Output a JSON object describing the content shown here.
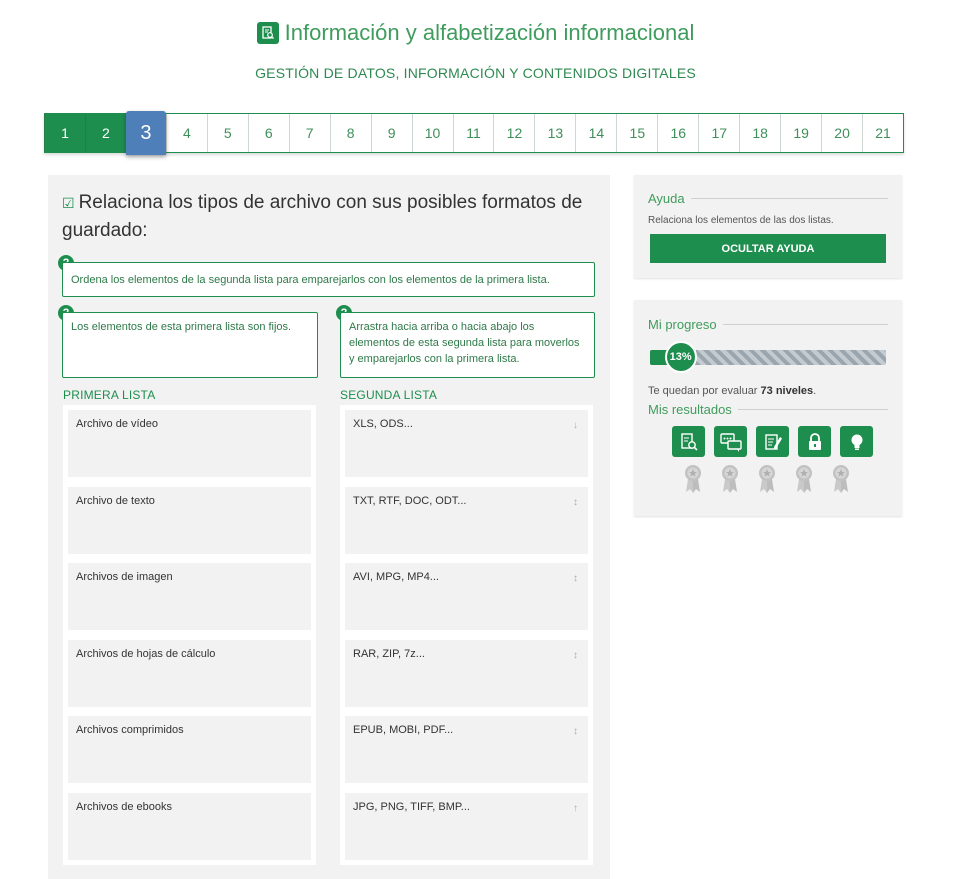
{
  "header": {
    "title": "Información y alfabetización informacional",
    "subtitle": "GESTIÓN DE DATOS, INFORMACIÓN Y CONTENIDOS DIGITALES",
    "icon": "document-search-icon"
  },
  "stepper": {
    "steps": [
      "1",
      "2",
      "3",
      "4",
      "5",
      "6",
      "7",
      "8",
      "9",
      "10",
      "11",
      "12",
      "13",
      "14",
      "15",
      "16",
      "17",
      "18",
      "19",
      "20",
      "21"
    ],
    "current": "3"
  },
  "question": {
    "text": "Relaciona los tipos de archivo con sus posibles formatos de guardado:",
    "icon": "checkbox-icon"
  },
  "hints": {
    "general": "Ordena los elementos de la segunda lista para emparejarlos con los elementos de la primera lista.",
    "first": "Los elementos de esta primera lista son fijos.",
    "second": "Arrastra hacia arriba o hacia abajo los elementos de esta segunda lista para moverlos y emparejarlos con la primera lista.",
    "icon": "question-icon"
  },
  "first_list": {
    "title": "PRIMERA LISTA",
    "items": [
      "Archivo de vídeo",
      "Archivo de texto",
      "Archivos de imagen",
      "Archivos de hojas de cálculo",
      "Archivos comprimidos",
      "Archivos de ebooks"
    ]
  },
  "second_list": {
    "title": "SEGUNDA LISTA",
    "items": [
      "XLS, ODS...",
      "TXT, RTF, DOC, ODT...",
      "AVI, MPG, MP4...",
      "RAR, ZIP, 7z...",
      "EPUB, MOBI, PDF...",
      "JPG, PNG, TIFF, BMP..."
    ],
    "arrows": [
      "↓",
      "↕",
      "↕",
      "↕",
      "↕",
      "↑"
    ]
  },
  "help": {
    "title": "Ayuda",
    "text": "Relaciona los elementos de las dos listas.",
    "button": "OCULTAR AYUDA"
  },
  "progress": {
    "title": "Mi progreso",
    "percent_label": "13%",
    "percent": 13,
    "remaining_prefix": "Te quedan por evaluar",
    "remaining_value": "73 niveles",
    "remaining_suffix": ".",
    "results_title": "Mis resultados",
    "result_icons": [
      "search-money-icon",
      "chat-bubbles-icon",
      "edit-document-icon",
      "lock-icon",
      "lightbulb-icon"
    ],
    "medal_icon": "medal-icon"
  },
  "colors": {
    "primary": "#1e8e4e",
    "current_step": "#4e7fb8"
  }
}
